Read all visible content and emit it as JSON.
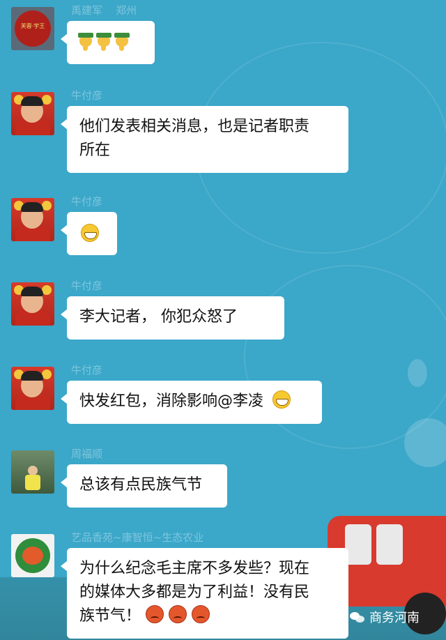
{
  "messages": [
    {
      "sender": "禹建军",
      "location": "郑州",
      "text": ""
    },
    {
      "sender": "牛付彦",
      "text": "他们发表相关消息，也是记者职责"
    },
    {
      "sender": "牛付彦",
      "text": ""
    },
    {
      "sender": "牛付彦",
      "text": "李大记者， 你犯众怒了"
    },
    {
      "sender": "牛付彦",
      "text": "快发红包，消除影响@李凌"
    },
    {
      "sender": "周福顺",
      "text": "总该有点民族气节"
    },
    {
      "sender": "艺品香苑~康智恒~生态农业",
      "text": "为什么纪念毛主席不多发些？现在"
    }
  ],
  "extra_lines": {
    "msg1_line2": "所在",
    "msg6_line2": "的媒体大多都是为了利益！没有民",
    "msg6_line3": "族节气！"
  },
  "avatars": {
    "msg0_logo_text": "芙蓉·宇王"
  },
  "watermark": {
    "label": "商务河南",
    "icon": "wechat-icon"
  },
  "colors": {
    "background": "#3ba7c9",
    "bubble": "#ffffff",
    "sender_name": "#7fc6dd"
  }
}
